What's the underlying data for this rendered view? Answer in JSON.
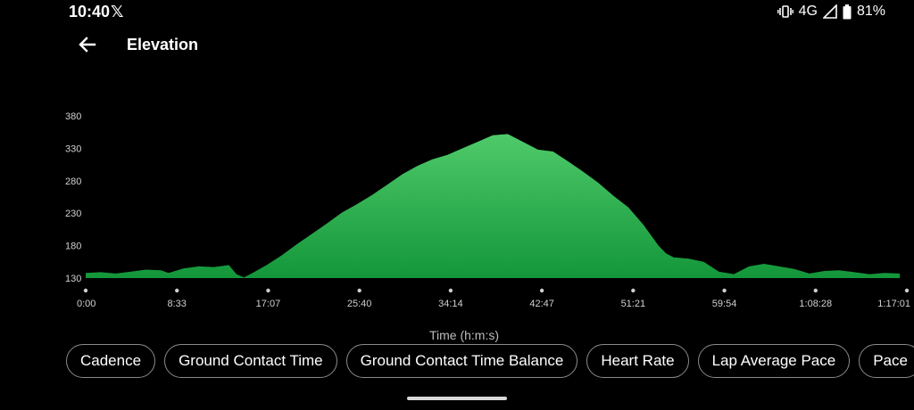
{
  "status": {
    "time": "10:40",
    "network": "4G",
    "battery": "81%"
  },
  "header": {
    "title": "Elevation"
  },
  "chips": [
    "Cadence",
    "Ground Contact Time",
    "Ground Contact Time Balance",
    "Heart Rate",
    "Lap Average Pace",
    "Pace"
  ],
  "colors": {
    "area_top": "#4fca6a",
    "area_bottom": "#13963a",
    "background": "#000000"
  },
  "chart_data": {
    "type": "area",
    "title": "",
    "xlabel": "Time (h:m:s)",
    "ylabel": "",
    "y_ticks": [
      130,
      180,
      230,
      280,
      330,
      380
    ],
    "x_ticks": [
      "0:00",
      "8:33",
      "17:07",
      "25:40",
      "34:14",
      "42:47",
      "51:21",
      "59:54",
      "1:08:28",
      "1:17:01"
    ],
    "x_unit": "minutes",
    "xlim": [
      0,
      77.02
    ],
    "ylim": [
      130,
      380
    ],
    "grid": false,
    "series": [
      {
        "values": [
          [
            0,
            138
          ],
          [
            2,
            139
          ],
          [
            4,
            137
          ],
          [
            6,
            140
          ],
          [
            8,
            143
          ],
          [
            10,
            142
          ],
          [
            11,
            138
          ],
          [
            13,
            145
          ],
          [
            15,
            148
          ],
          [
            17,
            147
          ],
          [
            19,
            150
          ],
          [
            20,
            136
          ],
          [
            21,
            131
          ],
          [
            22,
            137
          ],
          [
            24,
            150
          ],
          [
            26,
            165
          ],
          [
            28,
            182
          ],
          [
            30,
            198
          ],
          [
            32,
            214
          ],
          [
            34,
            231
          ],
          [
            36,
            244
          ],
          [
            38,
            258
          ],
          [
            40,
            274
          ],
          [
            42,
            290
          ],
          [
            44,
            303
          ],
          [
            46,
            313
          ],
          [
            48,
            320
          ],
          [
            50,
            330
          ],
          [
            52,
            340
          ],
          [
            54,
            350
          ],
          [
            56,
            352
          ],
          [
            58,
            340
          ],
          [
            60,
            328
          ],
          [
            62,
            325
          ],
          [
            64,
            310
          ],
          [
            66,
            294
          ],
          [
            68,
            277
          ],
          [
            70,
            257
          ],
          [
            72,
            239
          ],
          [
            74,
            212
          ],
          [
            76,
            180
          ],
          [
            77,
            168
          ],
          [
            78,
            162
          ],
          [
            80,
            160
          ],
          [
            82,
            155
          ],
          [
            84,
            140
          ],
          [
            86,
            136
          ],
          [
            88,
            148
          ],
          [
            90,
            152
          ],
          [
            92,
            148
          ],
          [
            94,
            144
          ],
          [
            96,
            137
          ],
          [
            98,
            141
          ],
          [
            100,
            142
          ],
          [
            102,
            139
          ],
          [
            104,
            136
          ],
          [
            106,
            138
          ],
          [
            108,
            137
          ]
        ]
      }
    ]
  }
}
